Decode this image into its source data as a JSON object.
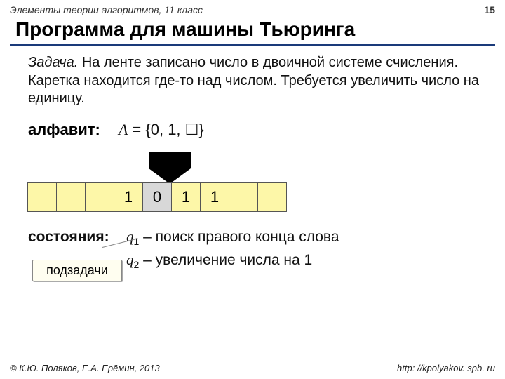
{
  "header": {
    "course": "Элементы теории алгоритмов, 11 класс",
    "page": "15"
  },
  "title": "Программа для машины Тьюринга",
  "task": {
    "label": "Задача.",
    "text": "На ленте записано число в двоичной системе счисления. Каретка находится где-то над числом. Требуется увеличить число на единицу."
  },
  "alphabet": {
    "label": "алфавит:",
    "value_pre": "A",
    "value_post": " = {0, 1, ☐}"
  },
  "tape": {
    "cells": [
      "",
      "",
      "",
      "1",
      "0",
      "1",
      "1",
      "",
      ""
    ],
    "head_index": 4
  },
  "states": {
    "label": "состояния:",
    "rows": [
      {
        "q": "q",
        "sub": "1",
        "text": " – поиск правого конца слова"
      },
      {
        "q": "q",
        "sub": "2",
        "text": " – увеличение числа на 1"
      }
    ]
  },
  "callout": "подзадачи",
  "footer": {
    "left": "© К.Ю. Поляков, Е.А. Ерёмин, 2013",
    "right": "http: //kpolyakov. spb. ru"
  }
}
